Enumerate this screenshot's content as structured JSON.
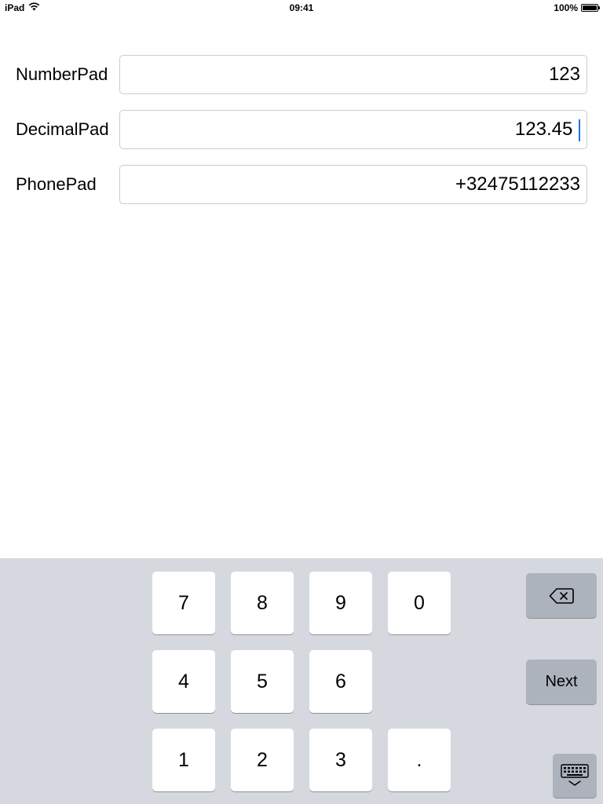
{
  "status_bar": {
    "device": "iPad",
    "time": "09:41",
    "battery": "100%",
    "battery_level": 1.0
  },
  "form": {
    "rows": [
      {
        "label": "NumberPad",
        "value": "123"
      },
      {
        "label": "DecimalPad",
        "value": "123.45"
      },
      {
        "label": "PhonePad",
        "value": "+32475112233"
      }
    ]
  },
  "keyboard": {
    "keys": {
      "k7": "7",
      "k8": "8",
      "k9": "9",
      "k0": "0",
      "k4": "4",
      "k5": "5",
      "k6": "6",
      "k1": "1",
      "k2": "2",
      "k3": "3",
      "kdot": "."
    },
    "next_label": "Next",
    "delete_icon": "backspace-icon",
    "dismiss_icon": "keyboard-dismiss-icon"
  },
  "colors": {
    "keyboard_bg": "#d5d8df",
    "key_bg": "#ffffff",
    "function_key_bg": "#adb3bc",
    "cursor": "#1a73e8",
    "field_border": "#cccccc"
  }
}
